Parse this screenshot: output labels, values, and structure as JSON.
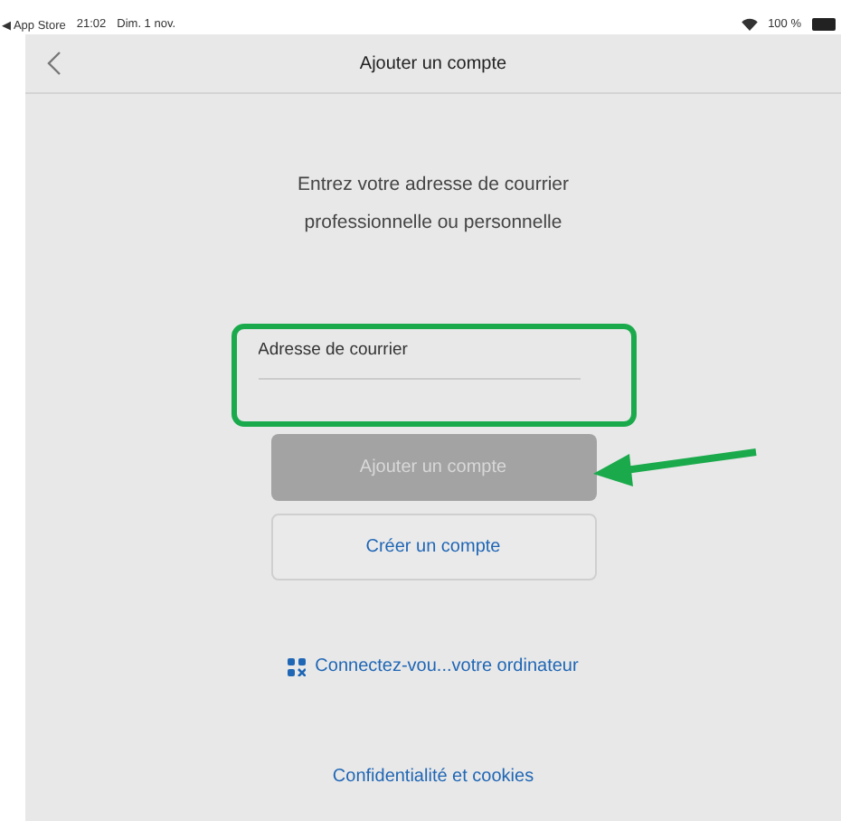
{
  "status_bar": {
    "back_app": "◀ App Store",
    "time": "21:02",
    "date": "Dim. 1 nov.",
    "battery": "100 %"
  },
  "nav": {
    "title": "Ajouter un compte"
  },
  "intro": "Entrez votre adresse de courrier professionnelle ou personnelle",
  "email_field": {
    "placeholder": "Adresse de courrier",
    "highlighted": true
  },
  "add_button": {
    "label": "Ajouter un compte",
    "disabled": true,
    "arrow": true
  },
  "create_button": {
    "label": "Créer un compte"
  },
  "qr_link": "Connectez-vou...votre ordinateur",
  "privacy_link": "Confidentialité et cookies"
}
